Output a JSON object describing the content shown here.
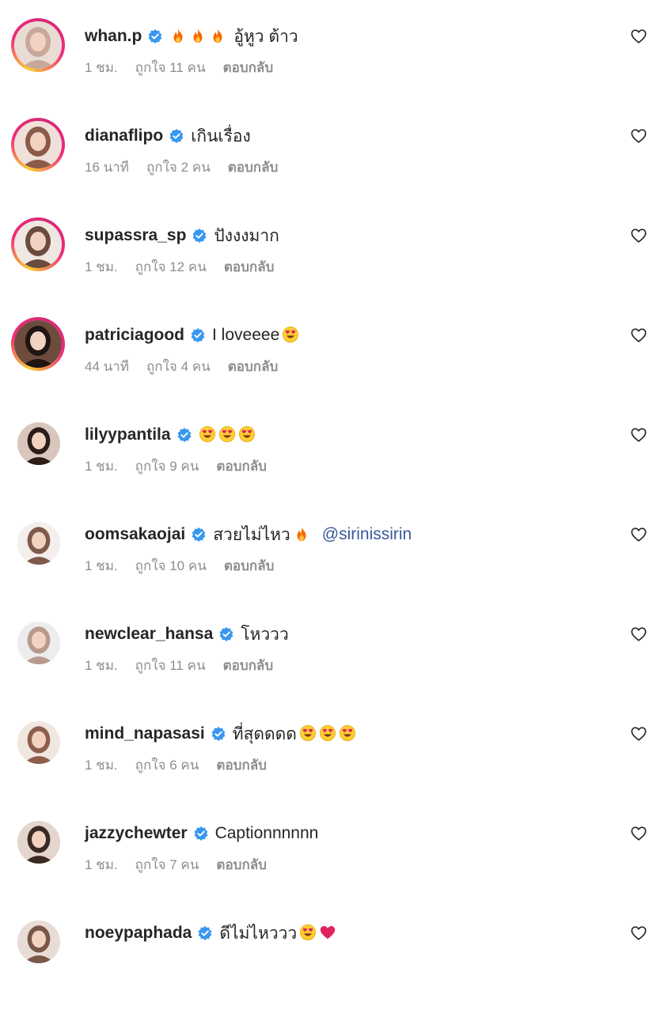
{
  "comments": [
    {
      "username": "whan.p",
      "text": "อู้หูว ต้าว",
      "emoji_before": [
        "fire",
        "fire",
        "fire"
      ],
      "emoji_after": [],
      "mention": "",
      "time": "1 ชม.",
      "likes": "ถูกใจ 11 คน",
      "reply": "ตอบกลับ",
      "story": true,
      "avatar_bg": "#e9dcd5",
      "avatar_fg": "#c7a89a"
    },
    {
      "username": "dianaflipo",
      "text": "เกินเรื่อง",
      "emoji_before": [],
      "emoji_after": [],
      "mention": "",
      "time": "16 นาที",
      "likes": "ถูกใจ 2 คน",
      "reply": "ตอบกลับ",
      "story": true,
      "avatar_bg": "#f0e0da",
      "avatar_fg": "#8a5b48"
    },
    {
      "username": "supassra_sp",
      "text": "ปังงงมาก",
      "emoji_before": [],
      "emoji_after": [],
      "mention": "",
      "time": "1 ชม.",
      "likes": "ถูกใจ 12 คน",
      "reply": "ตอบกลับ",
      "story": true,
      "avatar_bg": "#efe7e2",
      "avatar_fg": "#6b4b3d"
    },
    {
      "username": "patriciagood",
      "text": "I loveeee",
      "emoji_before": [],
      "emoji_after": [
        "heart-eyes"
      ],
      "mention": "",
      "time": "44 นาที",
      "likes": "ถูกใจ 4 คน",
      "reply": "ตอบกลับ",
      "story": true,
      "avatar_bg": "#6d4b3d",
      "avatar_fg": "#1f1512"
    },
    {
      "username": "lilyypantila",
      "text": "",
      "emoji_before": [],
      "emoji_after": [
        "heart-eyes",
        "heart-eyes",
        "heart-eyes"
      ],
      "mention": "",
      "time": "1 ชม.",
      "likes": "ถูกใจ 9 คน",
      "reply": "ตอบกลับ",
      "story": false,
      "avatar_bg": "#d9c7bd",
      "avatar_fg": "#2b1d18"
    },
    {
      "username": "oomsakaojai",
      "text": "สวยไม่ไหว",
      "emoji_before": [],
      "emoji_after": [
        "fire"
      ],
      "mention": "@sirinissirin",
      "time": "1 ชม.",
      "likes": "ถูกใจ 10 คน",
      "reply": "ตอบกลับ",
      "story": false,
      "avatar_bg": "#f4efec",
      "avatar_fg": "#7d5a49"
    },
    {
      "username": "newclear_hansa",
      "text": "โหววว",
      "emoji_before": [],
      "emoji_after": [],
      "mention": "",
      "time": "1 ชม.",
      "likes": "ถูกใจ 11 คน",
      "reply": "ตอบกลับ",
      "story": false,
      "avatar_bg": "#ededed",
      "avatar_fg": "#b79a8e"
    },
    {
      "username": "mind_napasasi",
      "text": "ที่สุดดดด",
      "emoji_before": [],
      "emoji_after": [
        "heart-eyes",
        "heart-eyes",
        "heart-eyes"
      ],
      "mention": "",
      "time": "1 ชม.",
      "likes": "ถูกใจ 6 คน",
      "reply": "ตอบกลับ",
      "story": false,
      "avatar_bg": "#f1e7e1",
      "avatar_fg": "#8c5f4b"
    },
    {
      "username": "jazzychewter",
      "text": "Captionnnnnn",
      "emoji_before": [],
      "emoji_after": [],
      "mention": "",
      "time": "1 ชม.",
      "likes": "ถูกใจ 7 คน",
      "reply": "ตอบกลับ",
      "story": false,
      "avatar_bg": "#e4d6cc",
      "avatar_fg": "#3a2a22"
    },
    {
      "username": "noeypaphada",
      "text": "ดีไม่ไหววว",
      "emoji_before": [],
      "emoji_after": [
        "heart-eyes",
        "red-heart"
      ],
      "mention": "",
      "time": "",
      "likes": "",
      "reply": "",
      "story": false,
      "avatar_bg": "#e8ddd6",
      "avatar_fg": "#7a5646"
    }
  ],
  "icons": {
    "verified": "verified-badge-icon",
    "like": "heart-outline-icon"
  },
  "colors": {
    "verified": "#3897f0",
    "fire": "#f56a00",
    "heart_eyes_face": "#ffcc33",
    "red_heart": "#e0245e",
    "secondary_text": "#8e8e8e",
    "mention": "#385898"
  }
}
